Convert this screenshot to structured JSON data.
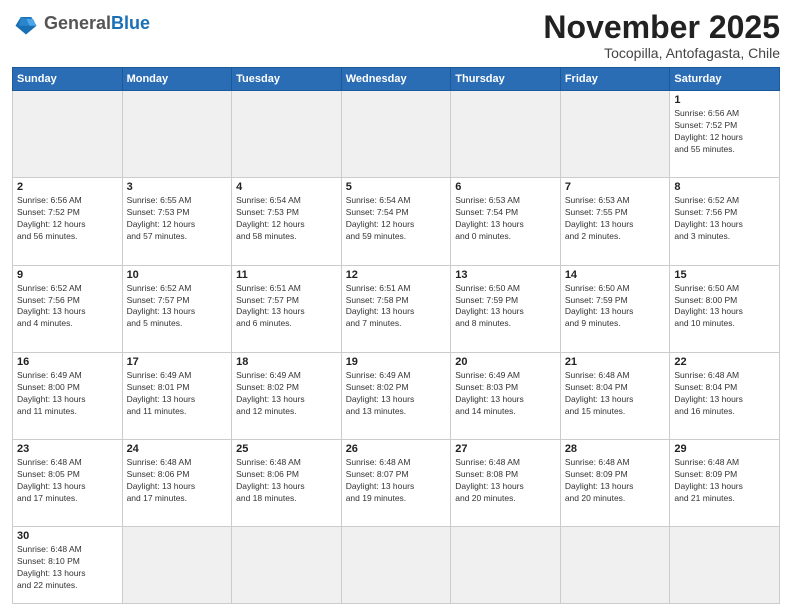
{
  "header": {
    "logo_general": "General",
    "logo_blue": "Blue",
    "month_title": "November 2025",
    "location": "Tocopilla, Antofagasta, Chile"
  },
  "days_of_week": [
    "Sunday",
    "Monday",
    "Tuesday",
    "Wednesday",
    "Thursday",
    "Friday",
    "Saturday"
  ],
  "weeks": [
    [
      {
        "day": "",
        "info": ""
      },
      {
        "day": "",
        "info": ""
      },
      {
        "day": "",
        "info": ""
      },
      {
        "day": "",
        "info": ""
      },
      {
        "day": "",
        "info": ""
      },
      {
        "day": "",
        "info": ""
      },
      {
        "day": "1",
        "info": "Sunrise: 6:56 AM\nSunset: 7:52 PM\nDaylight: 12 hours\nand 55 minutes."
      }
    ],
    [
      {
        "day": "2",
        "info": "Sunrise: 6:56 AM\nSunset: 7:52 PM\nDaylight: 12 hours\nand 56 minutes."
      },
      {
        "day": "3",
        "info": "Sunrise: 6:55 AM\nSunset: 7:53 PM\nDaylight: 12 hours\nand 57 minutes."
      },
      {
        "day": "4",
        "info": "Sunrise: 6:54 AM\nSunset: 7:53 PM\nDaylight: 12 hours\nand 58 minutes."
      },
      {
        "day": "5",
        "info": "Sunrise: 6:54 AM\nSunset: 7:54 PM\nDaylight: 12 hours\nand 59 minutes."
      },
      {
        "day": "6",
        "info": "Sunrise: 6:53 AM\nSunset: 7:54 PM\nDaylight: 13 hours\nand 0 minutes."
      },
      {
        "day": "7",
        "info": "Sunrise: 6:53 AM\nSunset: 7:55 PM\nDaylight: 13 hours\nand 2 minutes."
      },
      {
        "day": "8",
        "info": "Sunrise: 6:52 AM\nSunset: 7:56 PM\nDaylight: 13 hours\nand 3 minutes."
      }
    ],
    [
      {
        "day": "9",
        "info": "Sunrise: 6:52 AM\nSunset: 7:56 PM\nDaylight: 13 hours\nand 4 minutes."
      },
      {
        "day": "10",
        "info": "Sunrise: 6:52 AM\nSunset: 7:57 PM\nDaylight: 13 hours\nand 5 minutes."
      },
      {
        "day": "11",
        "info": "Sunrise: 6:51 AM\nSunset: 7:57 PM\nDaylight: 13 hours\nand 6 minutes."
      },
      {
        "day": "12",
        "info": "Sunrise: 6:51 AM\nSunset: 7:58 PM\nDaylight: 13 hours\nand 7 minutes."
      },
      {
        "day": "13",
        "info": "Sunrise: 6:50 AM\nSunset: 7:59 PM\nDaylight: 13 hours\nand 8 minutes."
      },
      {
        "day": "14",
        "info": "Sunrise: 6:50 AM\nSunset: 7:59 PM\nDaylight: 13 hours\nand 9 minutes."
      },
      {
        "day": "15",
        "info": "Sunrise: 6:50 AM\nSunset: 8:00 PM\nDaylight: 13 hours\nand 10 minutes."
      }
    ],
    [
      {
        "day": "16",
        "info": "Sunrise: 6:49 AM\nSunset: 8:00 PM\nDaylight: 13 hours\nand 11 minutes."
      },
      {
        "day": "17",
        "info": "Sunrise: 6:49 AM\nSunset: 8:01 PM\nDaylight: 13 hours\nand 11 minutes."
      },
      {
        "day": "18",
        "info": "Sunrise: 6:49 AM\nSunset: 8:02 PM\nDaylight: 13 hours\nand 12 minutes."
      },
      {
        "day": "19",
        "info": "Sunrise: 6:49 AM\nSunset: 8:02 PM\nDaylight: 13 hours\nand 13 minutes."
      },
      {
        "day": "20",
        "info": "Sunrise: 6:49 AM\nSunset: 8:03 PM\nDaylight: 13 hours\nand 14 minutes."
      },
      {
        "day": "21",
        "info": "Sunrise: 6:48 AM\nSunset: 8:04 PM\nDaylight: 13 hours\nand 15 minutes."
      },
      {
        "day": "22",
        "info": "Sunrise: 6:48 AM\nSunset: 8:04 PM\nDaylight: 13 hours\nand 16 minutes."
      }
    ],
    [
      {
        "day": "23",
        "info": "Sunrise: 6:48 AM\nSunset: 8:05 PM\nDaylight: 13 hours\nand 17 minutes."
      },
      {
        "day": "24",
        "info": "Sunrise: 6:48 AM\nSunset: 8:06 PM\nDaylight: 13 hours\nand 17 minutes."
      },
      {
        "day": "25",
        "info": "Sunrise: 6:48 AM\nSunset: 8:06 PM\nDaylight: 13 hours\nand 18 minutes."
      },
      {
        "day": "26",
        "info": "Sunrise: 6:48 AM\nSunset: 8:07 PM\nDaylight: 13 hours\nand 19 minutes."
      },
      {
        "day": "27",
        "info": "Sunrise: 6:48 AM\nSunset: 8:08 PM\nDaylight: 13 hours\nand 20 minutes."
      },
      {
        "day": "28",
        "info": "Sunrise: 6:48 AM\nSunset: 8:09 PM\nDaylight: 13 hours\nand 20 minutes."
      },
      {
        "day": "29",
        "info": "Sunrise: 6:48 AM\nSunset: 8:09 PM\nDaylight: 13 hours\nand 21 minutes."
      }
    ],
    [
      {
        "day": "30",
        "info": "Sunrise: 6:48 AM\nSunset: 8:10 PM\nDaylight: 13 hours\nand 22 minutes."
      },
      {
        "day": "",
        "info": ""
      },
      {
        "day": "",
        "info": ""
      },
      {
        "day": "",
        "info": ""
      },
      {
        "day": "",
        "info": ""
      },
      {
        "day": "",
        "info": ""
      },
      {
        "day": "",
        "info": ""
      }
    ]
  ]
}
